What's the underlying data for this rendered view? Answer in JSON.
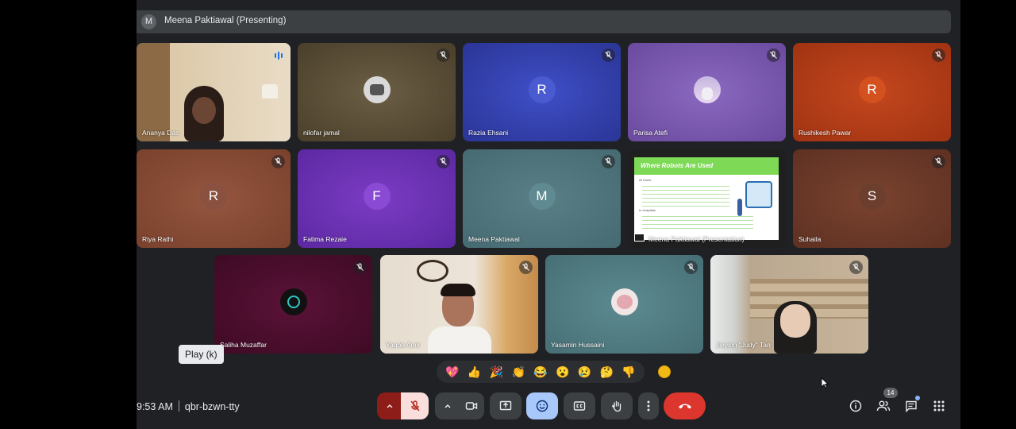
{
  "presenting_banner": {
    "initial": "M",
    "name": "Meena Paktiawal (Presenting)"
  },
  "tiles": [
    {
      "name": "Ananya Das",
      "type": "video",
      "speaking": true
    },
    {
      "name": "nilofar jamal",
      "type": "photo",
      "muted": true
    },
    {
      "name": "Razia Ehsani",
      "initial": "R",
      "muted": true
    },
    {
      "name": "Parisa Atefi",
      "type": "photo",
      "muted": true
    },
    {
      "name": "Rushikesh Pawar",
      "initial": "R",
      "muted": true
    },
    {
      "name": "Riya Rathi",
      "initial": "R",
      "muted": true
    },
    {
      "name": "Fatima Rezaie",
      "initial": "F",
      "muted": true
    },
    {
      "name": "Meena Paktiawal",
      "initial": "M",
      "muted": true
    },
    {
      "name": "Meena Paktiawal (Presentation)",
      "type": "presentation",
      "slide_title": "Where Robots Are Used",
      "slide_section": "At Home",
      "slide_section2": "In Hospitals"
    },
    {
      "name": "Suhaila",
      "initial": "S",
      "muted": true
    },
    {
      "name": "Saliha Muzaffar",
      "type": "photo",
      "muted": true
    },
    {
      "name": "Yaqob Amir",
      "type": "video",
      "muted": true
    },
    {
      "name": "Yasamin Hussaini",
      "type": "photo",
      "muted": true
    },
    {
      "name": "Jieying \"Judy\" Tan",
      "type": "video",
      "muted": true
    }
  ],
  "tooltip": "Play (k)",
  "reactions": [
    "💖",
    "👍",
    "🎉",
    "👏",
    "😂",
    "😮",
    "😢",
    "🤔",
    "👎"
  ],
  "meeting": {
    "time": "9:53 AM",
    "code": "qbr-bzwn-tty"
  },
  "participant_count": "14",
  "colors": {
    "accent": "#8ab4f8",
    "end_call": "#ea4335",
    "mic_off_bg": "#f9dedc",
    "reaction_active": "#a8c7fa"
  }
}
